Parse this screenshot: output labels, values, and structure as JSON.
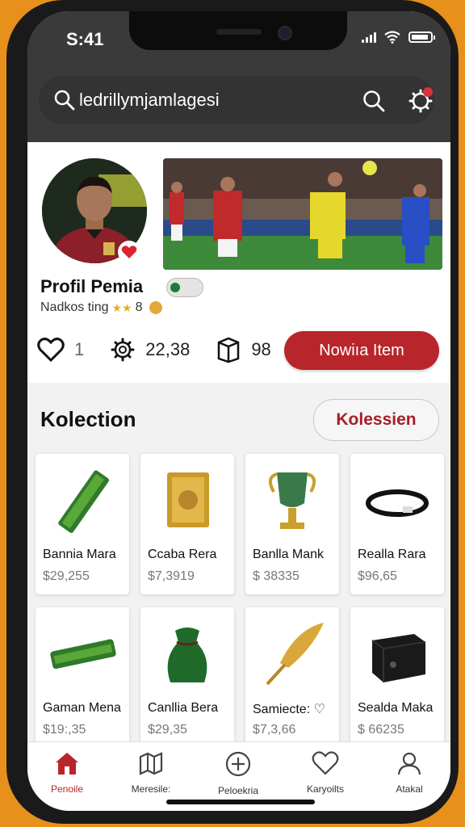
{
  "status_bar": {
    "time": "S:41"
  },
  "search": {
    "text": "ledrillymjamlagesi"
  },
  "profile": {
    "name": "Profil Pemia",
    "rating_text": "Nadkos ting",
    "rating_stars": "★★",
    "rating_value": "8",
    "likes": "1",
    "views": "22,38",
    "items": "98",
    "new_item_label": "Nowiıa Item"
  },
  "collection": {
    "title": "Kolection",
    "button_label": "Kolessien",
    "items": [
      {
        "name": "Bannia Mara",
        "price": "$29,255",
        "icon": "green-scarf-icon"
      },
      {
        "name": "Ccaba Rera",
        "price": "$7,3919",
        "icon": "gold-card-icon"
      },
      {
        "name": "Banlla Mank",
        "price": "$ 38335",
        "icon": "trophy-icon"
      },
      {
        "name": "Realla Rara",
        "price": "$96,65",
        "icon": "wristband-icon"
      },
      {
        "name": "Gaman Mena",
        "price": "$19:,35",
        "icon": "green-scarf-icon"
      },
      {
        "name": "Canllia Bera",
        "price": "$29,35",
        "icon": "green-pouch-icon"
      },
      {
        "name": "Samiecte: ♡",
        "price": "$7,3,66",
        "icon": "quill-icon"
      },
      {
        "name": "Sealda Maka",
        "price": "$ 66235",
        "icon": "black-box-icon"
      }
    ]
  },
  "tabs": [
    {
      "label": "Penoile",
      "icon": "home-icon",
      "active": true
    },
    {
      "label": "Meresile:",
      "icon": "map-icon",
      "active": false
    },
    {
      "label": "Peloekria",
      "icon": "add-circle-icon",
      "active": false
    },
    {
      "label": "Karyoilts",
      "icon": "favorite-icon",
      "active": false
    },
    {
      "label": "Atakal",
      "icon": "profile-icon",
      "active": false
    }
  ],
  "colors": {
    "accent": "#b8252a",
    "header": "#3a3a3a",
    "background": "#e8901c"
  }
}
